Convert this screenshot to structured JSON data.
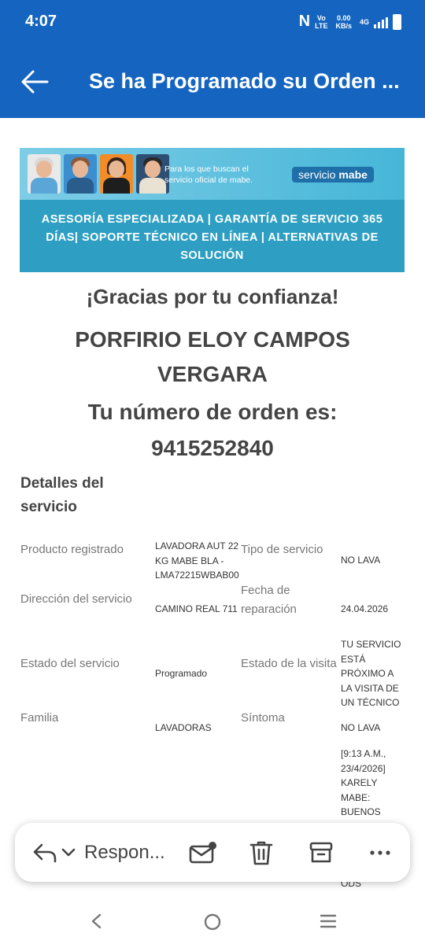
{
  "status_bar": {
    "time": "4:07",
    "network_top": "Vo",
    "network_bottom": "LTE",
    "speed_top": "0.00",
    "speed_bottom": "KB/s",
    "signal_type": "4G",
    "icons": [
      "nfc-icon",
      "volte-icon",
      "signal-icon",
      "battery-icon"
    ]
  },
  "app_bar": {
    "title": "Se ha Programado su Orden ..."
  },
  "banner": {
    "tagline": "Para los que buscan el servicio oficial de mabe.",
    "logo_light": "servicio",
    "logo_bold": "mabe",
    "services": "ASESORÍA ESPECIALIZADA | GARANTÍA DE SERVICIO 365 DÍAS| SOPORTE TÉCNICO EN LÍNEA | ALTERNATIVAS DE SOLUCIÓN"
  },
  "email": {
    "thanks": "¡Gracias por tu confianza!",
    "customer_name": "PORFIRIO ELOY CAMPOS VERGARA",
    "order_label": "Tu número de orden es:",
    "order_number": "9415252840",
    "details_title": "Detalles del servicio"
  },
  "details": {
    "producto_label": "Producto registrado",
    "producto_value": "LAVADORA AUT 22 KG MABE BLA - LMA72215WBAB00",
    "tipo_label": "Tipo de servicio",
    "tipo_value": "NO LAVA",
    "direccion_label": "Dirección del servicio",
    "direccion_value": "CAMINO REAL 711",
    "fecha_label": "Fecha de reparación",
    "fecha_value": "24.04.2026",
    "estado_label": "Estado del servicio",
    "estado_value": "Programado",
    "visita_label": "Estado de la visita",
    "visita_value": "TU SERVICIO ESTÁ PRÓXIMO A LA VISITA DE UN TÉCNICO",
    "familia_label": "Familia",
    "familia_value": "LAVADORAS",
    "sintoma_label": "Síntoma",
    "sintoma_value": "NO LAVA",
    "comment_value": "[9:13 A.M., 23/4/2026] KARELY MABE: BUENOS DIAS POR",
    "comment_tail": "ODS"
  },
  "action_bar": {
    "reply_label": "Respon..."
  },
  "colors": {
    "primary": "#1565c0",
    "banner_light": "#46b6d8",
    "banner_dark": "#2e9fc3"
  }
}
